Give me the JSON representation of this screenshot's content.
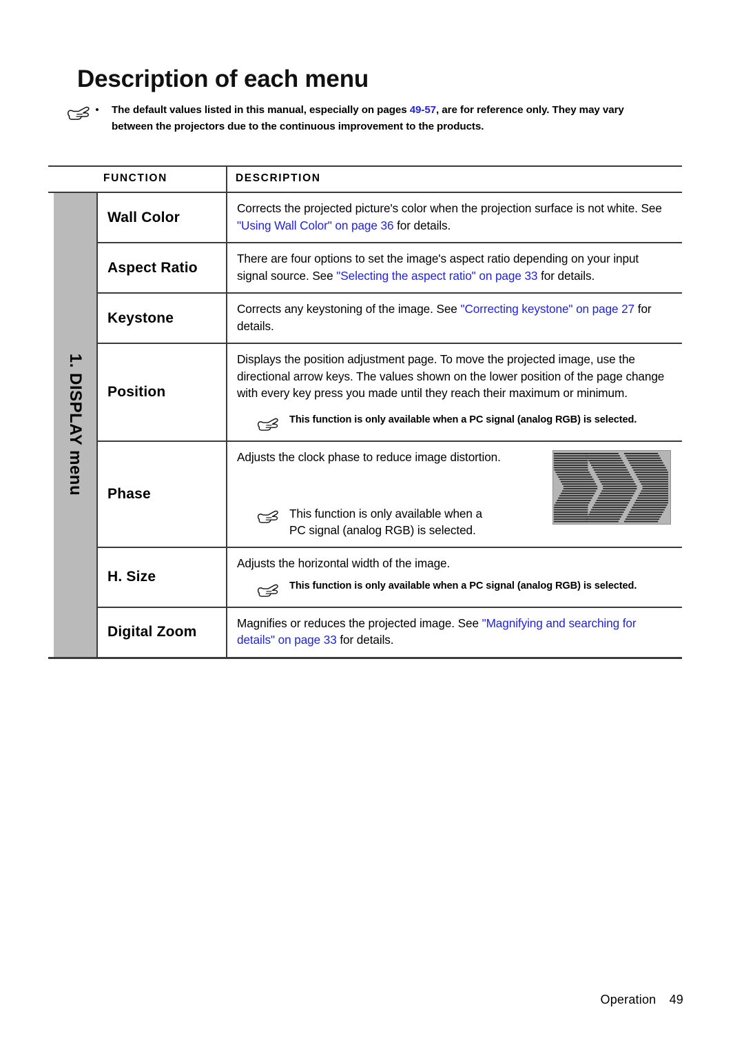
{
  "page": {
    "title": "Description of each menu",
    "footer_label": "Operation",
    "footer_page": "49"
  },
  "intro_note": {
    "icon": "pointing-hand-icon",
    "bullet": "•",
    "text_part1": "The default values listed in this manual, especially on pages ",
    "link1": "49-57",
    "text_part2": ", are for reference only. They may vary between the projectors due to the continuous improvement to the products."
  },
  "table": {
    "headers": {
      "function": "FUNCTION",
      "description": "DESCRIPTION"
    },
    "side_label": "1. DISPLAY menu",
    "side_color": "#bababa",
    "link_color": "#2222e0",
    "rule_color": "#3a3a3a",
    "rows": [
      {
        "function": "Wall Color",
        "desc_part1": "Corrects the projected picture's color when the projection surface is not white. See ",
        "link": "\"Using Wall Color\" on page 36",
        "desc_part2": " for details.",
        "note": null
      },
      {
        "function": "Aspect Ratio",
        "desc_part1": "There are four options to set the image's aspect ratio depending on your input signal source. See ",
        "link": "\"Selecting the aspect ratio\" on page 33",
        "desc_part2": " for details.",
        "note": null
      },
      {
        "function": "Keystone",
        "desc_part1": "Corrects any keystoning of the image. See ",
        "link": "\"Correcting keystone\" on page 27",
        "desc_part2": " for details.",
        "note": null
      },
      {
        "function": "Position",
        "desc_part1": "Displays the position adjustment page. To move the projected image, use the directional arrow keys. The values shown on the lower position of the page change with every key press you made until they reach their maximum or minimum.",
        "link": "",
        "desc_part2": "",
        "note": "This function is only available when a PC signal (analog RGB) is selected.",
        "note_icon": "pointing-hand-icon",
        "note_style": "bold"
      },
      {
        "function": "Phase",
        "desc_part1": "Adjusts the clock phase to reduce image distortion.",
        "link": "",
        "desc_part2": "",
        "note": "This function is only available when a PC signal (analog RGB) is selected.",
        "note_icon": "pointing-hand-icon",
        "note_style": "regular",
        "figure": "phase-distortion-pattern"
      },
      {
        "function": "H. Size",
        "desc_part1": "Adjusts the horizontal width of the image.",
        "link": "",
        "desc_part2": "",
        "note": "This function is only available when a PC signal (analog RGB) is selected.",
        "note_icon": "pointing-hand-icon",
        "note_style": "bold"
      },
      {
        "function": "Digital Zoom",
        "desc_part1": "Magnifies or reduces the projected image. See ",
        "link": "\"Magnifying and searching for details\" on page 33",
        "desc_part2": " for details.",
        "note": null
      }
    ]
  }
}
